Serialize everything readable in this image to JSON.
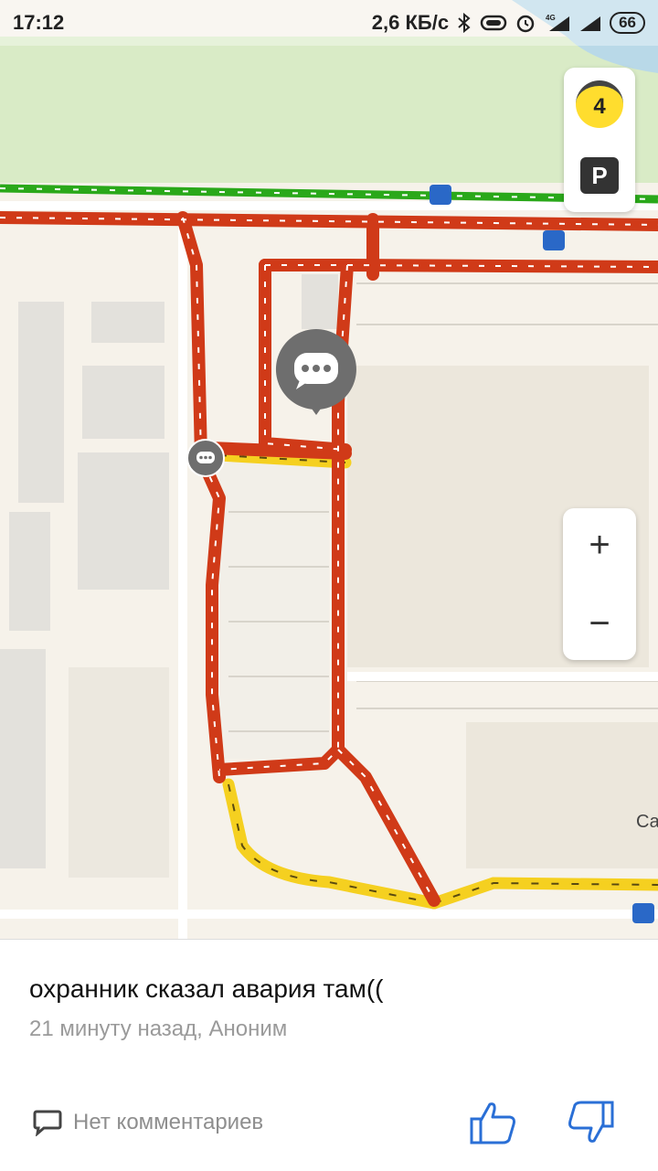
{
  "status_bar": {
    "time": "17:12",
    "network_speed": "2,6 КБ/с",
    "battery": "66",
    "network_type": "4G",
    "icons": [
      "bluetooth-icon",
      "vibrate-icon",
      "alarm-icon",
      "signal-icon",
      "signal-icon",
      "battery-icon"
    ]
  },
  "map": {
    "traffic_level": "4",
    "parking_label": "P",
    "zoom_in_label": "+",
    "zoom_out_label": "−",
    "partial_label": "Са",
    "colors": {
      "jam": "#d03a18",
      "slow": "#f5d020",
      "free": "#2aa81a",
      "park": "#d9ebc6"
    }
  },
  "event": {
    "title": "охранник сказал авария там((",
    "meta": "21 минуту назад, Аноним",
    "comments": "Нет комментариев"
  }
}
